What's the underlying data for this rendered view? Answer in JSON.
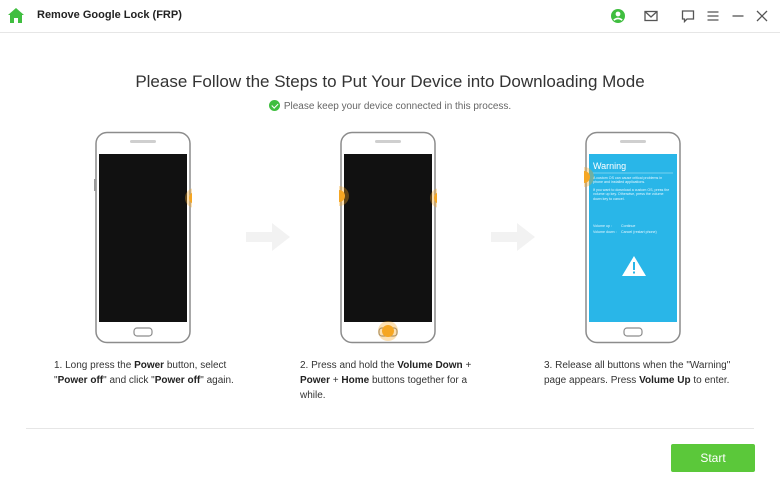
{
  "app": {
    "title": "Remove Google Lock (FRP)"
  },
  "titlebar_icons": [
    "home-icon",
    "account-icon",
    "mail-icon",
    "feedback-icon",
    "menu-icon",
    "minimize-icon",
    "close-icon"
  ],
  "main": {
    "headline": "Please Follow the Steps to Put Your Device into Downloading Mode",
    "note": "Please keep your device connected in this process.",
    "steps": [
      {
        "parts": [
          {
            "t": "1. Long press the ",
            "b": false
          },
          {
            "t": "Power",
            "b": true
          },
          {
            "t": " button, select \"",
            "b": false
          },
          {
            "t": "Power off",
            "b": true
          },
          {
            "t": "\" and click \"",
            "b": false
          },
          {
            "t": "Power off",
            "b": true
          },
          {
            "t": "\" again.",
            "b": false
          }
        ]
      },
      {
        "parts": [
          {
            "t": "2. Press and hold the ",
            "b": false
          },
          {
            "t": "Volume Down",
            "b": true
          },
          {
            "t": " + ",
            "b": false
          },
          {
            "t": "Power",
            "b": true
          },
          {
            "t": " + ",
            "b": false
          },
          {
            "t": "Home",
            "b": true
          },
          {
            "t": " buttons together for a while.",
            "b": false
          }
        ]
      },
      {
        "parts": [
          {
            "t": "3. Release all buttons when the \"Warning\" page appears. Press ",
            "b": false
          },
          {
            "t": "Volume Up",
            "b": true
          },
          {
            "t": " to enter.",
            "b": false
          }
        ]
      }
    ],
    "warning_screen": {
      "title": "Warning",
      "body1": "A custom OS can cause critical problems in phone and installed applications.",
      "body2": "If you want to download a custom OS, press the volume up key. Otherwise, press the volume down key to cancel.",
      "opt1_key": "Volume up :",
      "opt1_val": "Continue",
      "opt2_key": "Volume down :",
      "opt2_val": "Cancel (restart phone)"
    }
  },
  "footer": {
    "start_label": "Start"
  },
  "colors": {
    "accent": "#5bc83a",
    "warning_screen": "#29b6e8",
    "highlight": "#f5a623"
  }
}
